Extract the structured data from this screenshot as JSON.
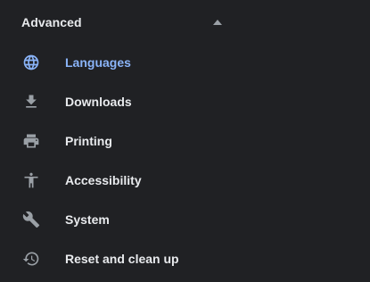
{
  "section": {
    "title": "Advanced",
    "expanded": true,
    "toggle_icon": "triangle-up-icon"
  },
  "colors": {
    "background": "#202124",
    "text": "#e8eaed",
    "icon": "#9aa0a6",
    "active": "#8ab4f8"
  },
  "menu": {
    "items": [
      {
        "label": "Languages",
        "icon": "globe-icon",
        "active": true
      },
      {
        "label": "Downloads",
        "icon": "download-icon",
        "active": false
      },
      {
        "label": "Printing",
        "icon": "printer-icon",
        "active": false
      },
      {
        "label": "Accessibility",
        "icon": "accessibility-icon",
        "active": false
      },
      {
        "label": "System",
        "icon": "wrench-icon",
        "active": false
      },
      {
        "label": "Reset and clean up",
        "icon": "history-icon",
        "active": false
      }
    ]
  }
}
